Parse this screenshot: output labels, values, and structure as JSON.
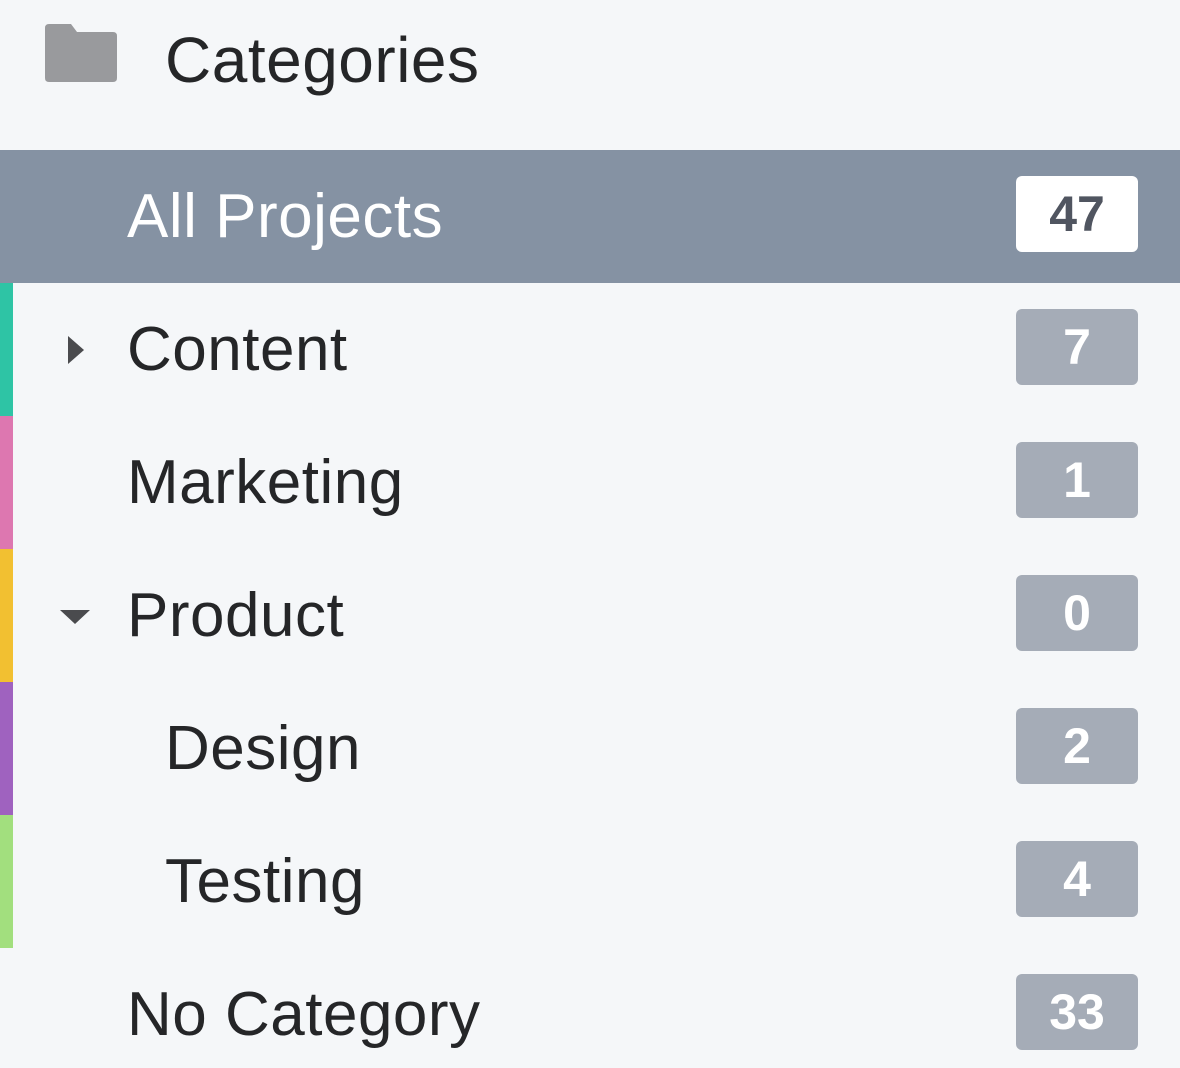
{
  "header": {
    "title": "Categories",
    "icon": "folder-icon"
  },
  "colors": {
    "selected_bg": "#8592a3",
    "badge_bg": "#a5acb7",
    "page_bg": "#f5f7f9"
  },
  "categories": [
    {
      "label": "All Projects",
      "count": "47",
      "selected": true,
      "color": null,
      "caret": null,
      "level": 0
    },
    {
      "label": "Content",
      "count": "7",
      "selected": false,
      "color": "#2ec4a5",
      "caret": "caret-right-icon",
      "level": 0
    },
    {
      "label": "Marketing",
      "count": "1",
      "selected": false,
      "color": "#dd77b0",
      "caret": null,
      "level": 0
    },
    {
      "label": "Product",
      "count": "0",
      "selected": false,
      "color": "#f2c031",
      "caret": "caret-down-icon",
      "level": 0
    },
    {
      "label": "Design",
      "count": "2",
      "selected": false,
      "color": "#9f62bf",
      "caret": null,
      "level": 1
    },
    {
      "label": "Testing",
      "count": "4",
      "selected": false,
      "color": "#a2df7e",
      "caret": null,
      "level": 1
    },
    {
      "label": "No Category",
      "count": "33",
      "selected": false,
      "color": null,
      "caret": null,
      "level": 0
    }
  ]
}
